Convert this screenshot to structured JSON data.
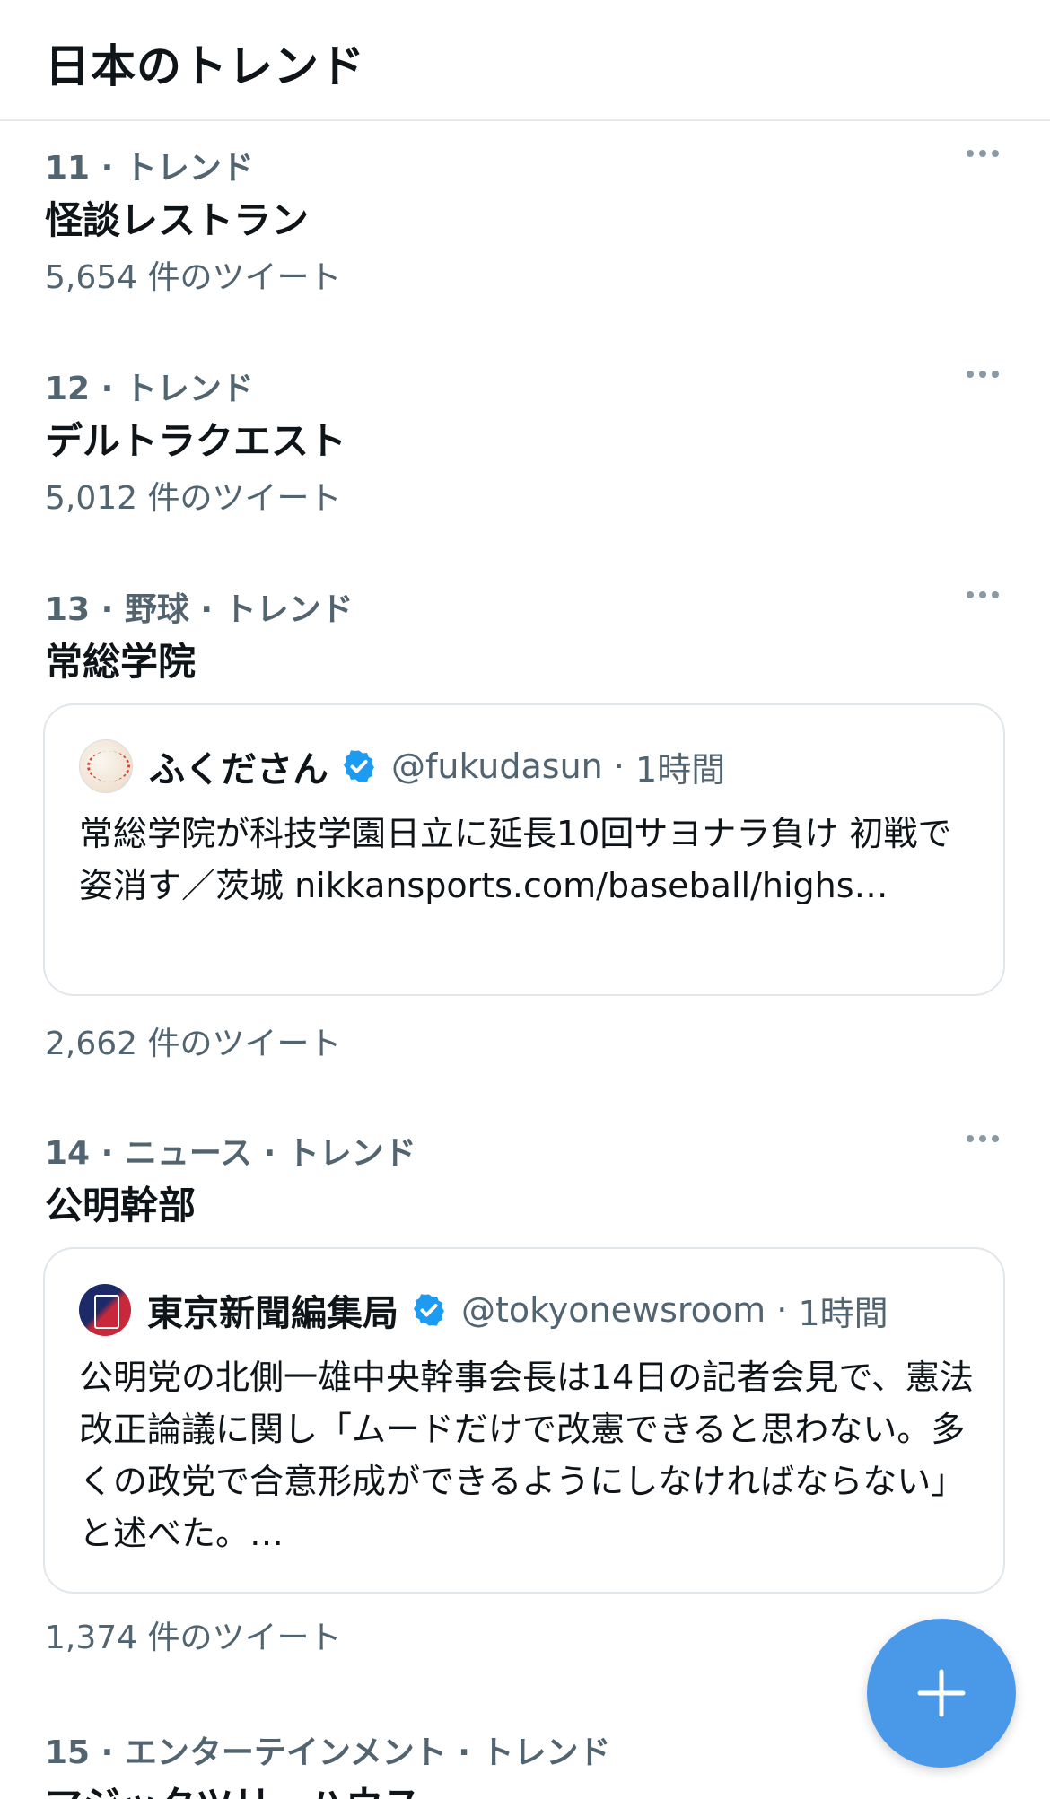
{
  "header": {
    "title": "日本のトレンド"
  },
  "trends": [
    {
      "meta": "11 · トレンド",
      "title": "怪談レストラン",
      "count": "5,654 件のツイート"
    },
    {
      "meta": "12 · トレンド",
      "title": "デルトラクエスト",
      "count": "5,012 件のツイート"
    },
    {
      "meta": "13 · 野球 · トレンド",
      "title": "常総学院",
      "tweet": {
        "author": "ふくださん",
        "handle": "@fukudasun",
        "time": "1時間",
        "text": "常総学院が科技学園日立に延長10回サヨナラ負け 初戦で姿消す／茨城 nikkansports.com/baseball/highs…"
      },
      "count": "2,662 件のツイート"
    },
    {
      "meta": "14 · ニュース · トレンド",
      "title": "公明幹部",
      "tweet": {
        "author": "東京新聞編集局",
        "handle": "@tokyonewsroom",
        "time": "1時間",
        "text": "公明党の北側一雄中央幹事会長は14日の記者会見で、憲法改正論議に関し「ムードだけで改憲できると思わない。多くの政党で合意形成ができるようにしなければならない」と述べた。…"
      },
      "count": "1,374 件のツイート"
    },
    {
      "meta": "15 · エンターテインメント · トレンド",
      "title": "マジックツリーハウス"
    }
  ],
  "fab": {
    "icon": "plus-icon"
  },
  "colors": {
    "accent": "#4a99e9",
    "muted": "#536471",
    "verified": "#1d9bf0"
  }
}
